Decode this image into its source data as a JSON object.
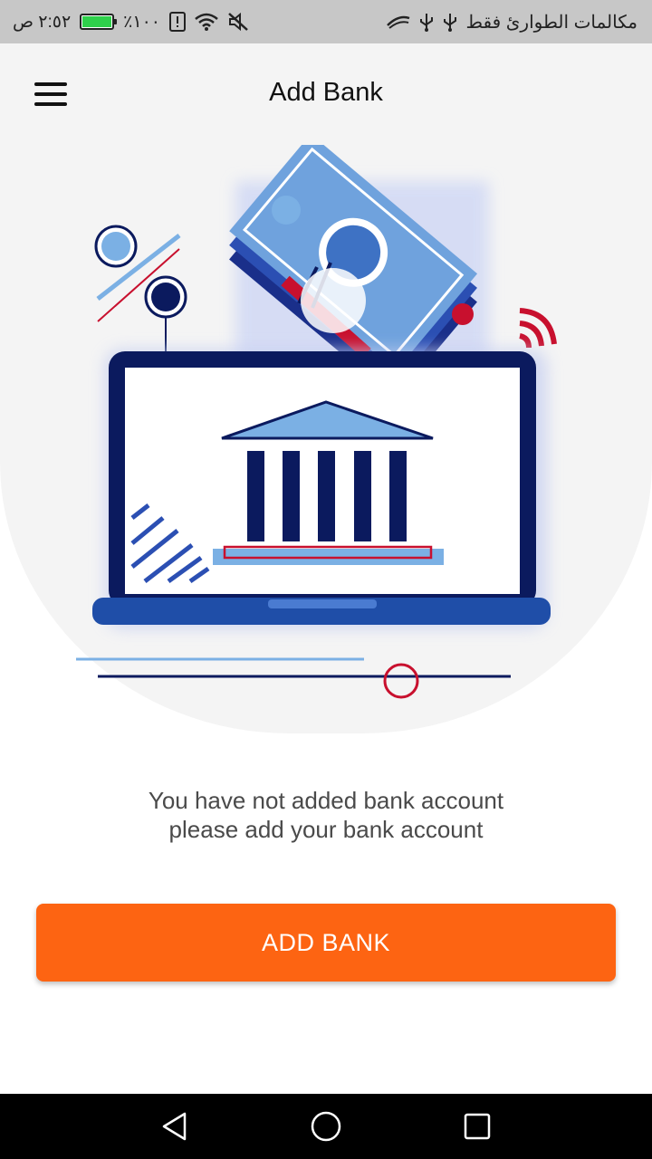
{
  "status_bar": {
    "time": "٢:٥٢ ص",
    "battery_text": "٪١٠٠",
    "carrier_text": "مكالمات الطوارئ فقط",
    "battery_color": "#2fd04b"
  },
  "header": {
    "title": "Add Bank",
    "menu_icon": "hamburger-menu-icon"
  },
  "hero": {
    "illustration": "bank-laptop-illustration"
  },
  "message": {
    "line1": "You have not added bank account",
    "line2": "please add your bank account"
  },
  "action": {
    "add_bank_label": "ADD BANK",
    "button_color": "#fd6412"
  },
  "nav_bar": {
    "back_icon": "back-triangle-icon",
    "home_icon": "home-circle-icon",
    "recents_icon": "recents-square-icon"
  }
}
